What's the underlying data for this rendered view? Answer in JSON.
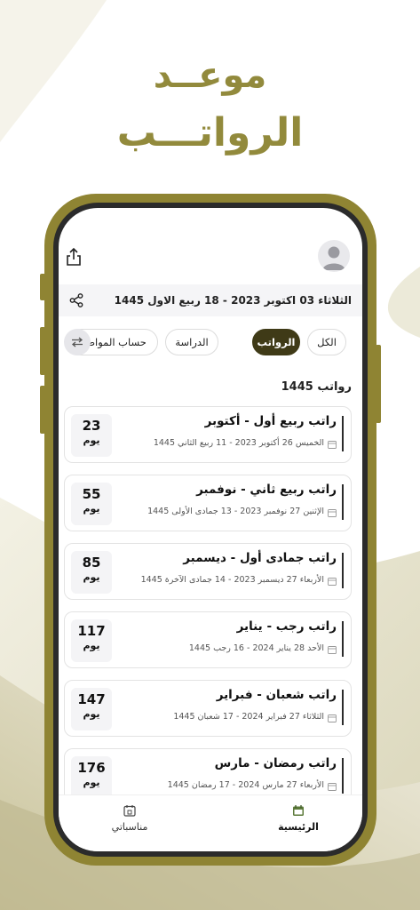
{
  "colors": {
    "brand_gold": "#928a3c",
    "phone_frame": "#8f8433",
    "chip_active": "#3f3a17"
  },
  "headline": {
    "line1": "موعــد",
    "line2": "الرواتـــب"
  },
  "app": {
    "top_icons": {
      "share": "share-upload-icon",
      "avatar": "user-avatar-icon"
    },
    "date_bar": {
      "text": "الثلاثاء 03 اكتوبر 2023 - 18 ربيع الاول 1445",
      "icon": "share-icon"
    },
    "filters": {
      "swap_icon": "swap-arrows-icon",
      "chips": [
        "الكل",
        "الرواتب",
        "الدراسة",
        "حساب المواطن"
      ],
      "selected": "الرواتب"
    },
    "section_title": "رواتب 1445",
    "salaries": [
      {
        "title": "راتب ربيع أول - أكتوبر",
        "date": "الخميس 26 أكتوبر 2023 - 11 ربيع الثاني 1445",
        "days": "23",
        "unit": "يوم"
      },
      {
        "title": "راتب ربيع ثاني - نوفمبر",
        "date": "الإثنين 27 نوفمبر 2023 - 13 جمادى الأولى 1445",
        "days": "55",
        "unit": "يوم"
      },
      {
        "title": "راتب جمادى أول - ديسمبر",
        "date": "الأربعاء 27 ديسمبر 2023 - 14 جمادى الآخرة 1445",
        "days": "85",
        "unit": "يوم"
      },
      {
        "title": "راتب رجب - يناير",
        "date": "الأحد 28 يناير 2024 - 16 رجب 1445",
        "days": "117",
        "unit": "يوم"
      },
      {
        "title": "راتب شعبان - فبراير",
        "date": "الثلاثاء 27 فبراير 2024 - 17 شعبان 1445",
        "days": "147",
        "unit": "يوم"
      },
      {
        "title": "راتب رمضان - مارس",
        "date": "الأربعاء 27 مارس 2024 - 17 رمضان 1445",
        "days": "176",
        "unit": "يوم"
      }
    ],
    "bottom_nav": [
      {
        "label": "الرئيسية",
        "icon": "calendar-home-icon",
        "active": true
      },
      {
        "label": "مناسباتي",
        "icon": "calendar-events-icon",
        "active": false
      }
    ]
  }
}
